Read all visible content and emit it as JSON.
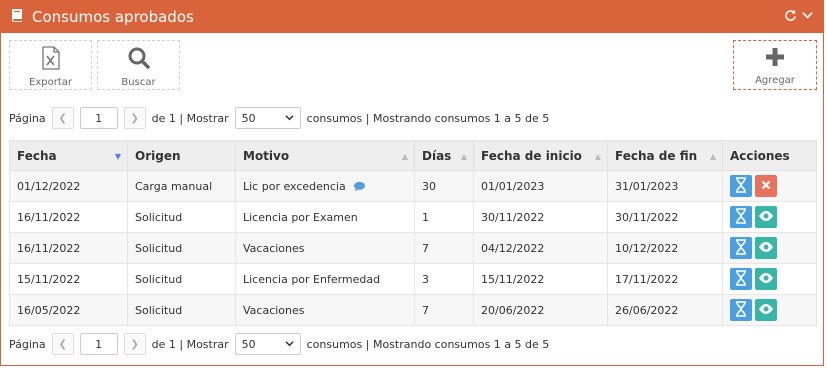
{
  "header": {
    "title": "Consumos aprobados",
    "colors": {
      "header_bg": "#d9633a"
    }
  },
  "toolbar": {
    "export_label": "Exportar",
    "search_label": "Buscar",
    "add_label": "Agregar"
  },
  "pagination": {
    "page_label": "Página",
    "page_value": "1",
    "of_label": "de 1 | Mostrar",
    "page_size": "50",
    "summary": "consumos | Mostrando consumos 1 a 5 de 5"
  },
  "table": {
    "columns": [
      "Fecha",
      "Origen",
      "Motivo",
      "Días",
      "Fecha de inicio",
      "Fecha de fin",
      "Acciones"
    ],
    "rows": [
      {
        "fecha": "01/12/2022",
        "origen": "Carga manual",
        "motivo": "Lic por excedencia",
        "dias": "30",
        "inicio": "01/01/2023",
        "fin": "31/01/2023",
        "has_comment": true,
        "actions": [
          "hourglass-icon",
          "close-icon"
        ]
      },
      {
        "fecha": "16/11/2022",
        "origen": "Solicitud",
        "motivo": "Licencia por Examen",
        "dias": "1",
        "inicio": "30/11/2022",
        "fin": "30/11/2022",
        "actions": [
          "hourglass-icon",
          "eye-icon"
        ]
      },
      {
        "fecha": "16/11/2022",
        "origen": "Solicitud",
        "motivo": "Vacaciones",
        "dias": "7",
        "inicio": "04/12/2022",
        "fin": "10/12/2022",
        "actions": [
          "hourglass-icon",
          "eye-icon"
        ]
      },
      {
        "fecha": "15/11/2022",
        "origen": "Solicitud",
        "motivo": "Licencia por Enfermedad",
        "dias": "3",
        "inicio": "15/11/2022",
        "fin": "17/11/2022",
        "actions": [
          "hourglass-icon",
          "eye-icon"
        ]
      },
      {
        "fecha": "16/05/2022",
        "origen": "Solicitud",
        "motivo": "Vacaciones",
        "dias": "7",
        "inicio": "20/06/2022",
        "fin": "26/06/2022",
        "actions": [
          "hourglass-icon",
          "eye-icon"
        ]
      }
    ]
  }
}
